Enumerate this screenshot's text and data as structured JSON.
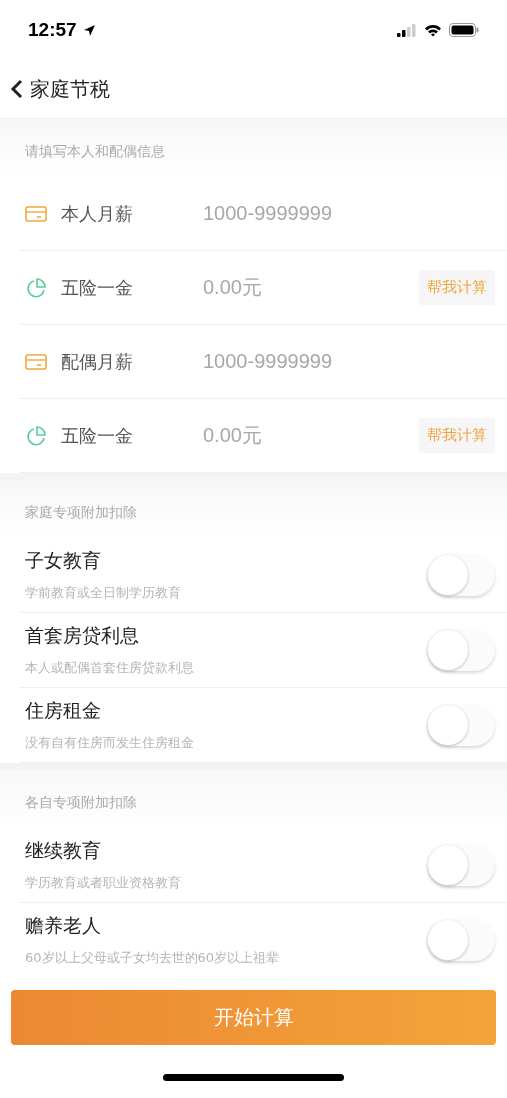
{
  "status_bar": {
    "time": "12:57"
  },
  "nav": {
    "title": "家庭节税"
  },
  "info_section": {
    "header": "请填写本人和配偶信息",
    "fields": [
      {
        "kind": "salary",
        "label": "本人月薪",
        "placeholder": "1000-9999999"
      },
      {
        "kind": "insurance",
        "label": "五险一金",
        "placeholder": "0.00元",
        "action": "帮我计算"
      },
      {
        "kind": "salary",
        "label": "配偶月薪",
        "placeholder": "1000-9999999"
      },
      {
        "kind": "insurance",
        "label": "五险一金",
        "placeholder": "0.00元",
        "action": "帮我计算"
      }
    ]
  },
  "deduction_sections": [
    {
      "header": "家庭专项附加扣除",
      "items": [
        {
          "title": "子女教育",
          "subtitle": "学前教育或全日制学历教育",
          "on": false
        },
        {
          "title": "首套房贷利息",
          "subtitle": "本人或配偶首套住房贷款利息",
          "on": false
        },
        {
          "title": "住房租金",
          "subtitle": "没有自有住房而发生住房租金",
          "on": false
        }
      ]
    },
    {
      "header": "各自专项附加扣除",
      "items": [
        {
          "title": "继续教育",
          "subtitle": "学历教育或者职业资格教育",
          "on": false
        },
        {
          "title": "赡养老人",
          "subtitle": "60岁以上父母或子女均去世的60岁以上祖辈",
          "on": false
        }
      ]
    }
  ],
  "submit": "开始计算"
}
